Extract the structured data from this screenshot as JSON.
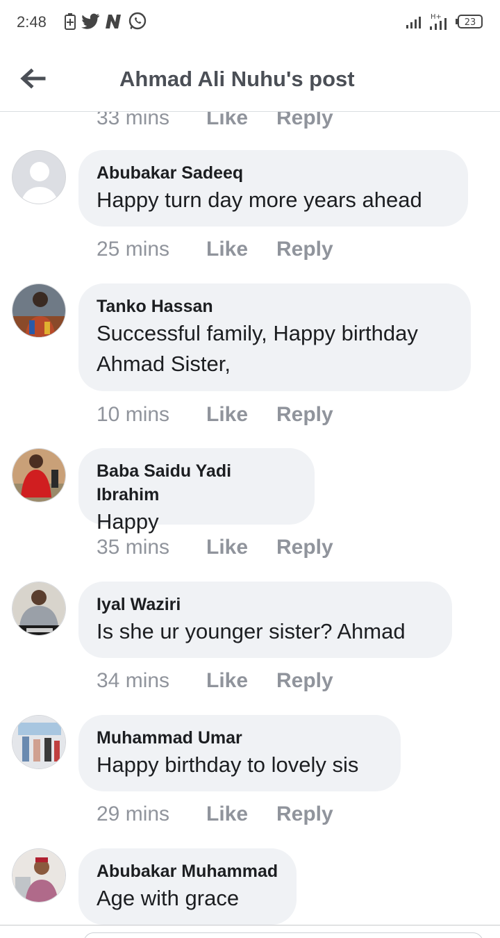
{
  "status_bar": {
    "time": "2:48",
    "left_icons": [
      "battery-saver-icon",
      "twitter-icon",
      "nairaland-icon",
      "whatsapp-icon"
    ],
    "network": "H+",
    "battery_level": "23"
  },
  "header": {
    "back_icon": "arrow-left-icon",
    "title": "Ahmad Ali Nuhu's post"
  },
  "first_meta": {
    "time": "33 mins",
    "like": "Like",
    "reply": "Reply"
  },
  "comments": [
    {
      "name": "Abubakar Sadeeq",
      "lines": [
        "Happy turn day more years ahead"
      ],
      "time": "25 mins",
      "like": "Like",
      "reply": "Reply",
      "avatar": "default-avatar"
    },
    {
      "name": "Tanko Hassan",
      "lines": [
        "Successful family, Happy birthday",
        "Ahmad Sister,"
      ],
      "time": "10 mins",
      "like": "Like",
      "reply": "Reply",
      "avatar": "photo"
    },
    {
      "name": "Baba Saidu Yadi Ibrahim",
      "lines": [
        "Happy"
      ],
      "time": "35 mins",
      "like": "Like",
      "reply": "Reply",
      "avatar": "photo"
    },
    {
      "name": "Iyal Waziri",
      "lines": [
        "Is she ur younger sister? Ahmad"
      ],
      "time": "34 mins",
      "like": "Like",
      "reply": "Reply",
      "avatar": "photo"
    },
    {
      "name": "Muhammad Umar",
      "lines": [
        "Happy birthday to lovely sis"
      ],
      "time": "29 mins",
      "like": "Like",
      "reply": "Reply",
      "avatar": "photo"
    },
    {
      "name": "Abubakar Muhammad",
      "lines": [
        "Age with grace"
      ],
      "time": "",
      "like": "",
      "reply": "",
      "avatar": "photo"
    }
  ],
  "colors": {
    "bubble": "#f0f2f5",
    "meta_text": "#90949c",
    "title_text": "#4b4f56",
    "divider": "#dadde1"
  }
}
